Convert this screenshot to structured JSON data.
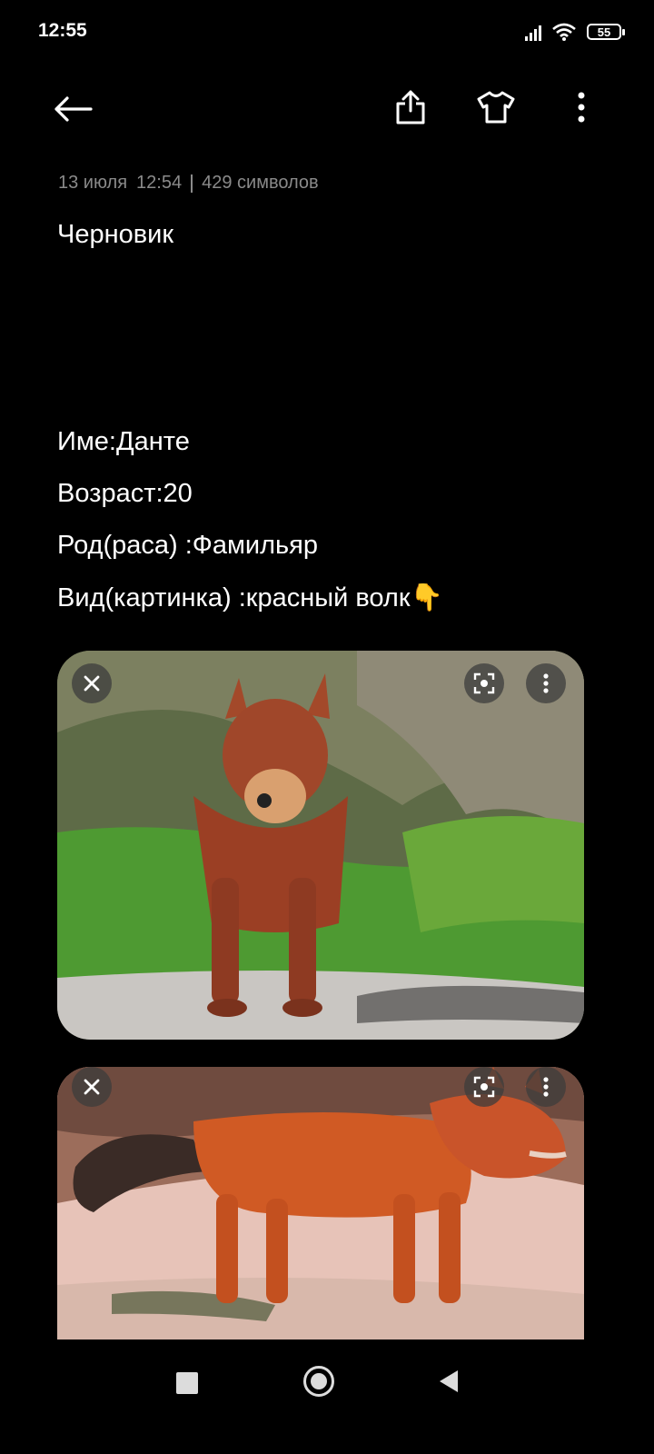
{
  "status_bar": {
    "time": "12:55",
    "battery": "55"
  },
  "toolbar": {
    "back_icon": "arrow-left-icon",
    "share_icon": "share-icon",
    "theme_icon": "tshirt-icon",
    "more_icon": "more-vertical-icon"
  },
  "note": {
    "date": "13 июля",
    "time": "12:54",
    "char_count": "429 символов",
    "title": "Черновик",
    "lines": [
      "Име:Данте",
      "Возраст:20",
      "Род(раса) :Фамильяр",
      "Вид(картинка) :красный волк"
    ],
    "emoji": "👇"
  },
  "images": [
    {
      "name": "red-wolf-front",
      "actions": [
        "close-icon",
        "lens-icon",
        "more-vertical-icon"
      ]
    },
    {
      "name": "red-wolf-side",
      "actions": [
        "close-icon",
        "lens-icon",
        "more-vertical-icon"
      ]
    }
  ],
  "colors": {
    "background": "#000000",
    "text": "#ffffff",
    "meta_text": "#8a8a8a"
  }
}
